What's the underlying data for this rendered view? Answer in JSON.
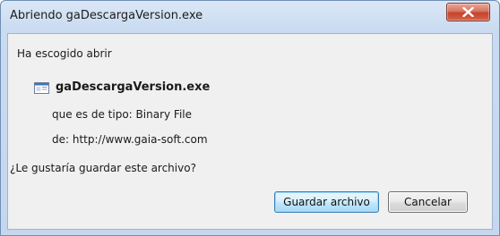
{
  "window": {
    "title": "Abriendo gaDescargaVersion.exe",
    "close_icon": "close-icon"
  },
  "dialog": {
    "intro": "Ha escogido abrir",
    "file_icon": "executable-file-icon",
    "filename": "gaDescargaVersion.exe",
    "type_text": "que es de tipo:  Binary File",
    "source_text": "de:  http://www.gaia-soft.com",
    "question": "¿Le gustaría guardar este archivo?"
  },
  "buttons": {
    "save_label": "Guardar archivo",
    "cancel_label": "Cancelar"
  },
  "colors": {
    "close_button": "#c9503a",
    "primary_button_border": "#3c7fb1",
    "window_frame": "#c4d7ef"
  }
}
